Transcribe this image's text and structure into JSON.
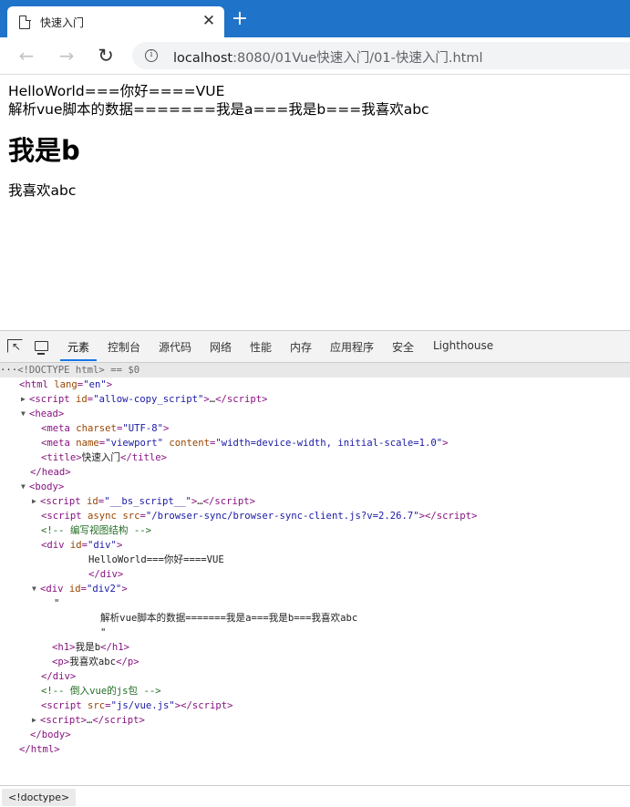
{
  "browser": {
    "tab_title": "快速入门",
    "tab_close": "✕",
    "new_tab": "+",
    "url_host": "localhost",
    "url_rest": ":8080/01Vue快速入门/01-快速入门.html"
  },
  "page": {
    "line1": "HelloWorld===你好====VUE",
    "line2": "解析vue脚本的数据=======我是a===我是b===我喜欢abc",
    "heading": "我是b",
    "paragraph": "我喜欢abc"
  },
  "devtools": {
    "tabs": [
      "元素",
      "控制台",
      "源代码",
      "网络",
      "性能",
      "内存",
      "应用程序",
      "安全",
      "Lighthouse"
    ],
    "active_tab": "元素",
    "doctype_row": {
      "prefix": "···",
      "text": "<!DOCTYPE html>",
      "suffix": " == $0"
    },
    "dom": {
      "html_open": {
        "tag": "html",
        "attr": "lang",
        "val": "\"en\""
      },
      "script_allow": {
        "attr": "id",
        "val": "\"allow-copy_script\""
      },
      "meta_charset": {
        "attr": "charset",
        "val": "\"UTF-8\""
      },
      "meta_viewport": {
        "attr1": "name",
        "val1": "\"viewport\"",
        "attr2": "content",
        "val2": "\"width=device-width, initial-scale=1.0\""
      },
      "title_text": "快速入门",
      "script_bs": {
        "attr": "id",
        "val": "\"__bs_script__\""
      },
      "script_async": {
        "attr1": "async",
        "attr2": "src",
        "val": "\"/browser-sync/browser-sync-client.js?v=2.26.7\""
      },
      "comment_view": "<!-- 编写视图结构 -->",
      "div_id": "\"div\"",
      "div_text": "HelloWorld===你好====VUE",
      "div2_id": "\"div2\"",
      "quote": "\"",
      "div2_text": "解析vue脚本的数据=======我是a===我是b===我喜欢abc",
      "h1_text": "我是b",
      "p_text": "我喜欢abc",
      "comment_js": "<!-- 倒入vue的js包 -->",
      "script_vue_src": "\"js/vue.js\""
    },
    "breadcrumb": "<!doctype>"
  }
}
